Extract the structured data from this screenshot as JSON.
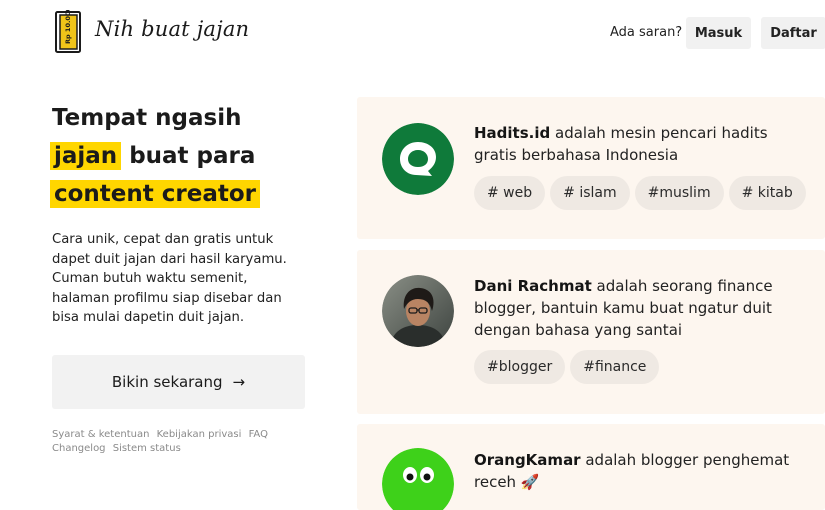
{
  "header": {
    "logo_badge": "Rp 10.000",
    "logo_text": "Nih buat jajan",
    "suggest_label": "Ada saran?",
    "login_label": "Masuk",
    "register_label": "Daftar"
  },
  "hero": {
    "line1": "Tempat ngasih",
    "line2_highlight": "jajan",
    "line2_rest": " buat para",
    "line3_highlight": "content creator",
    "description": "Cara unik, cepat dan gratis untuk dapet duit jajan dari hasil karyamu. Cuman butuh waktu semenit, halaman profilmu siap disebar dan bisa mulai dapetin duit jajan.",
    "cta_label": "Bikin sekarang",
    "cta_arrow": "→"
  },
  "footer": {
    "links": [
      "Syarat & ketentuan",
      "Kebijakan privasi",
      "FAQ",
      "Changelog",
      "Sistem status"
    ]
  },
  "creators": [
    {
      "name": "Hadits.id",
      "description": " adalah mesin pencari hadits gratis berbahasa Indonesia",
      "tags": [
        "# web",
        "# islam",
        "#muslim",
        "# kitab"
      ],
      "avatar_color": "#0f7a3a"
    },
    {
      "name": "Dani Rachmat",
      "description": " adalah seorang finance blogger, bantuin kamu buat ngatur duit dengan bahasa yang santai",
      "tags": [
        "#blogger",
        "#finance"
      ]
    },
    {
      "name": "OrangKamar",
      "description": " adalah blogger penghemat receh 🚀",
      "tags": [],
      "avatar_color": "#3ed11a"
    }
  ],
  "colors": {
    "highlight": "#ffd600",
    "card_bg": "#fdf6ef",
    "tag_bg": "#efe9e3",
    "button_bg": "#f1f1f1"
  }
}
